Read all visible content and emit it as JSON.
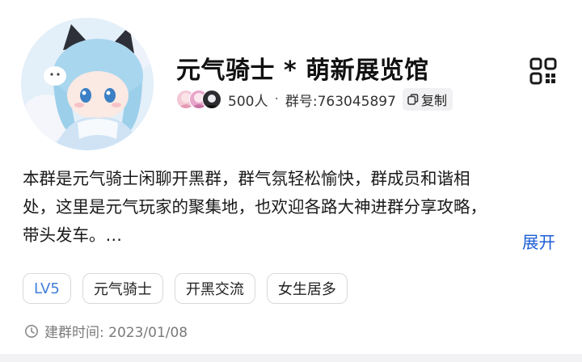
{
  "group": {
    "name": "元气骑士 * 萌新展览馆",
    "member_count": "500人",
    "separator": "·",
    "group_id": "群号:763045897",
    "copy_label": "复制",
    "qr_icon": "qr-code-icon"
  },
  "description": {
    "lines": [
      "本群是元气骑士闲聊开黑群，群气氛轻松愉快，群成员和谐相",
      "处，这里是元气玩家的聚集地，也欢迎各路大神进群分享攻略，",
      "带头发车。…"
    ],
    "expand_label": "展开"
  },
  "tags": [
    {
      "label": "LV5"
    },
    {
      "label": "元气骑士"
    },
    {
      "label": "开黑交流"
    },
    {
      "label": "女生居多"
    }
  ],
  "created": {
    "label": "建群时间: 2023/01/08",
    "icon": "clock-icon"
  },
  "colors": {
    "accent_link": "#1e5fd6",
    "level_tag": "#3f7fd8",
    "tag_border": "#d9d9dc",
    "muted_text": "#7a7a7a"
  }
}
